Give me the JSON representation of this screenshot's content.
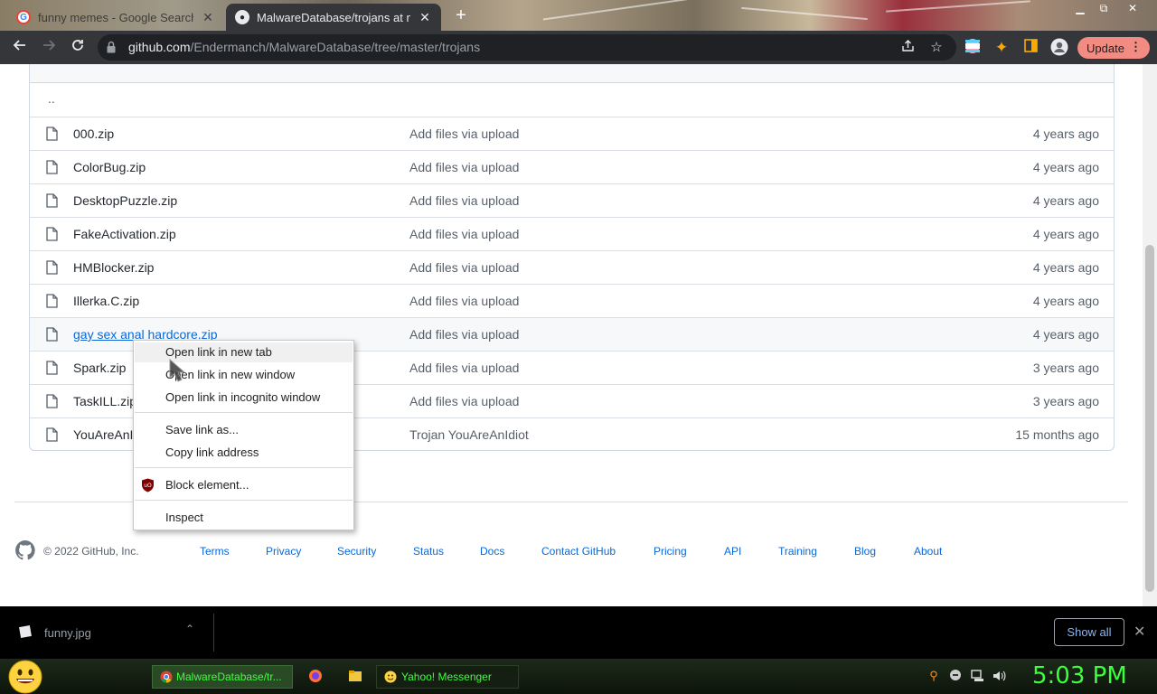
{
  "browser": {
    "tabs": [
      {
        "title": "funny memes - Google Search",
        "active": false
      },
      {
        "title": "MalwareDatabase/trojans at master",
        "active": true
      }
    ],
    "new_tab": "+",
    "window_controls": {
      "minimize": "▁",
      "restore": "⧉",
      "close": "✕"
    },
    "url_host": "github.com",
    "url_path": "/Endermanch/MalwareDatabase/tree/master/trojans",
    "update_label": "Update",
    "update_menu": "⋮",
    "colors": {
      "update": "#f28b82",
      "toolbar": "#35363a",
      "omnibox": "#202124"
    }
  },
  "repo": {
    "parent_dir": "..",
    "files": [
      {
        "name": "000.zip",
        "message": "Add files via upload",
        "age": "4 years ago"
      },
      {
        "name": "ColorBug.zip",
        "message": "Add files via upload",
        "age": "4 years ago"
      },
      {
        "name": "DesktopPuzzle.zip",
        "message": "Add files via upload",
        "age": "4 years ago"
      },
      {
        "name": "FakeActivation.zip",
        "message": "Add files via upload",
        "age": "4 years ago"
      },
      {
        "name": "HMBlocker.zip",
        "message": "Add files via upload",
        "age": "4 years ago"
      },
      {
        "name": "Illerka.C.zip",
        "message": "Add files via upload",
        "age": "4 years ago"
      },
      {
        "name": "gay sex anal hardcore.zip",
        "message": "Add files via upload",
        "age": "4 years ago"
      },
      {
        "name": "Spark.zip",
        "message": "Add files via upload",
        "age": "3 years ago"
      },
      {
        "name": "TaskILL.zip",
        "message": "Add files via upload",
        "age": "3 years ago"
      },
      {
        "name": "YouAreAnI",
        "message": "Trojan YouAreAnIdiot",
        "age": "15 months ago"
      }
    ]
  },
  "footer": {
    "copyright": "© 2022 GitHub, Inc.",
    "links": [
      "Terms",
      "Privacy",
      "Security",
      "Status",
      "Docs",
      "Contact GitHub",
      "Pricing",
      "API",
      "Training",
      "Blog",
      "About"
    ]
  },
  "context_menu": {
    "open_new_tab": "Open link in new tab",
    "open_new_window": "Open link in new window",
    "open_incognito": "Open link in incognito window",
    "save_link": "Save link as...",
    "copy_link": "Copy link address",
    "block_element": "Block element...",
    "inspect": "Inspect"
  },
  "downloads": {
    "file": "funny.jpg",
    "chevron": "⌃",
    "show_all": "Show all",
    "close": "✕"
  },
  "taskbar": {
    "chrome_task": "MalwareDatabase/tr...",
    "yahoo_task": "Yahoo! Messenger",
    "clock": "5:03 PM",
    "text_color": "#3cff3c"
  }
}
